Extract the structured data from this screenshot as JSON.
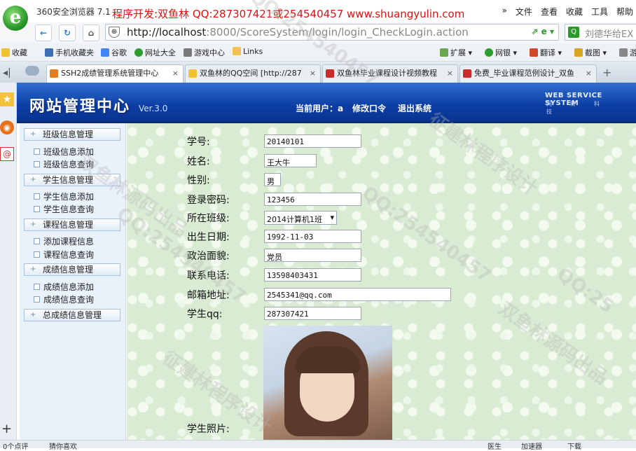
{
  "browser": {
    "name": "360安全浏览器 7.1",
    "promo": "程序开发:双鱼林 QQ:287307421或254540457 www.shuangyulin.com",
    "menu": [
      "»",
      "文件",
      "查看",
      "收藏",
      "工具",
      "帮助"
    ]
  },
  "address": {
    "url_host": "http://localhost",
    "url_path": ":8000/ScoreSystem/login/login_CheckLogin.action",
    "search_text": "刘德华给EX"
  },
  "favorites": [
    "收藏",
    "手机收藏夹",
    "谷歌",
    "网址大全",
    "游戏中心",
    "Links",
    "扩展",
    "网银",
    "翻译",
    "截图",
    "游"
  ],
  "tabs": [
    {
      "label": "SSH2成绩管理系统管理中心",
      "color": "#e57c20"
    },
    {
      "label": "双鱼林的QQ空间 [http://287",
      "color": "#f1c232"
    },
    {
      "label": "双鱼林毕业课程设计视频教程",
      "color": "#cc2b2b"
    },
    {
      "label": "免费_毕业课程范例设计_双鱼",
      "color": "#cc2b2b"
    }
  ],
  "header": {
    "title": "网站管理中心",
    "version": "Ver.3.0",
    "current_user": "当前用户：a",
    "change_password": "修改口令",
    "logout": "退出系统",
    "ws_title": "WEB SERVICE SYSTEM",
    "ws_sub": "网新科技"
  },
  "nav": {
    "class_mgmt": "班级信息管理",
    "class_add": "班级信息添加",
    "class_query": "班级信息查询",
    "student_mgmt": "学生信息管理",
    "student_add": "学生信息添加",
    "student_query": "学生信息查询",
    "course_mgmt": "课程信息管理",
    "course_add": "添加课程信息",
    "course_query": "课程信息查询",
    "score_mgmt": "成绩信息管理",
    "score_add": "成绩信息添加",
    "score_query": "成绩信息查询",
    "total_score_mgmt": "总成绩信息管理"
  },
  "form": {
    "student_no_label": "学号:",
    "student_no": "20140101",
    "name_label": "姓名:",
    "name": "王大牛",
    "gender_label": "性别:",
    "gender": "男",
    "password_label": "登录密码:",
    "password": "123456",
    "class_label": "所在班级:",
    "class": "2014计算机1班",
    "birth_label": "出生日期:",
    "birth": "1992-11-03",
    "politics_label": "政治面貌:",
    "politics": "党员",
    "phone_label": "联系电话:",
    "phone": "13598403431",
    "email_label": "邮箱地址:",
    "email": "2545341@qq.com",
    "qq_label": "学生qq:",
    "qq": "287307421",
    "photo_label": "学生照片:"
  },
  "status": {
    "left": "0个点评",
    "left2": "猜你喜欢",
    "right": [
      "医生",
      "加速器",
      "下载"
    ]
  },
  "watermarks": [
    "QQ:254540457",
    "双鱼林源码出品",
    "征建林程序设计",
    "QQ:254540457",
    "双鱼林源码出品",
    "征建林程序设计",
    "QQ:254540457",
    "QQ:25"
  ]
}
